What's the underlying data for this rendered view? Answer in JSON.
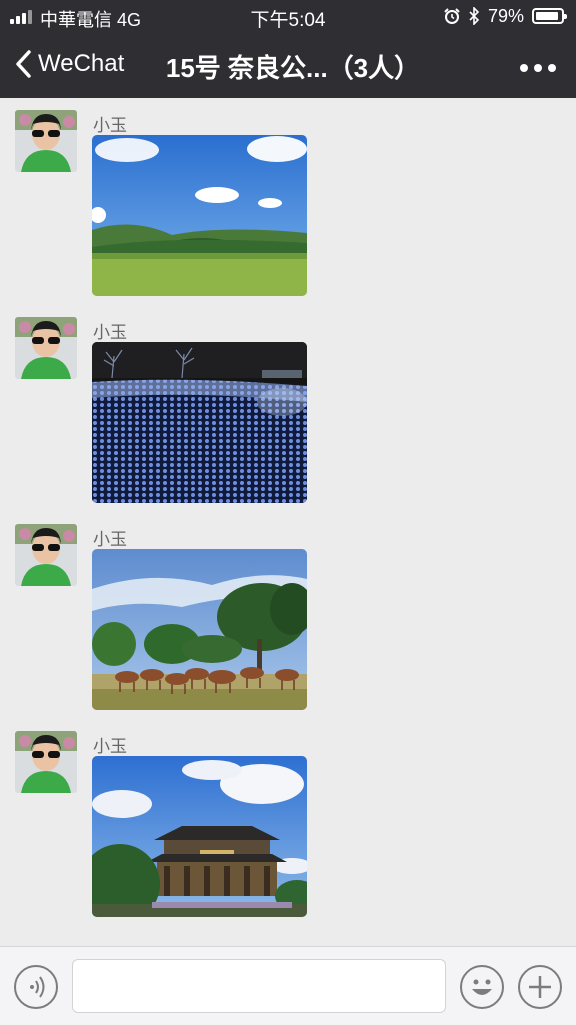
{
  "status": {
    "carrier": "中華電信 4G",
    "time": "下午5:04",
    "battery": "79%",
    "battery_level": 0.79
  },
  "nav": {
    "back_label": "WeChat",
    "title": "15号 奈良公...（3人）"
  },
  "messages": [
    {
      "sender": "小玉",
      "photo": "park-meadow-photo"
    },
    {
      "sender": "小玉",
      "photo": "blue-light-field-photo"
    },
    {
      "sender": "小玉",
      "photo": "deer-under-trees-photo"
    },
    {
      "sender": "小玉",
      "photo": "temple-hall-photo"
    }
  ],
  "input": {
    "value": ""
  }
}
